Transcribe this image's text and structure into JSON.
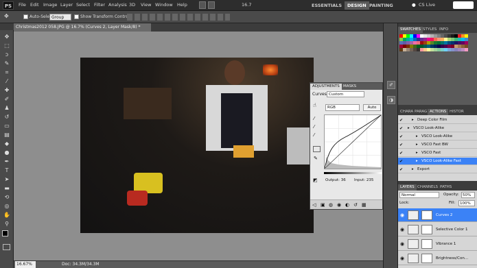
{
  "menu": {
    "logo": "PS",
    "items": [
      "File",
      "Edit",
      "Image",
      "Layer",
      "Select",
      "Filter",
      "Analysis",
      "3D",
      "View",
      "Window",
      "Help"
    ],
    "zoom": "16.7",
    "workspaces": [
      "ESSENTIALS",
      "DESIGN",
      "PAINTING"
    ],
    "active_workspace": "DESIGN",
    "cs_live": "CS Live"
  },
  "options": {
    "auto_select_label": "Auto-Select:",
    "auto_select_value": "Group",
    "show_transform_label": "Show Transform Controls"
  },
  "document": {
    "tab_title": "Christmas2012 058.JPG @ 16.7% (Curves 2, Layer Mask/8) *",
    "zoom_status": "16.67%",
    "doc_status": "Doc: 34.3M/34.3M"
  },
  "adjustments": {
    "tabs": [
      "ADJUSTMENTS",
      "MASKS"
    ],
    "active_tab": "ADJUSTMENTS",
    "type_label": "Curves",
    "preset": "Custom",
    "channel": "RGB",
    "auto_label": "Auto",
    "output_label": "Output: 36",
    "input_label": "Input: 235"
  },
  "swatches": {
    "tabs": [
      "SWATCHES",
      "STYLES",
      "INFO"
    ],
    "active_tab": "SWATCHES",
    "colors": [
      "#ff0000",
      "#ffff00",
      "#00ff00",
      "#00ffff",
      "#0000ff",
      "#ff00ff",
      "#ffffff",
      "#e6e6e6",
      "#cccccc",
      "#b3b3b3",
      "#999999",
      "#808080",
      "#666666",
      "#4d4d4d",
      "#333333",
      "#1a1a1a",
      "#000000",
      "#ed1c24",
      "#f7941d",
      "#fff200",
      "#8dc63f",
      "#00a651",
      "#00a99d",
      "#00aeef",
      "#0072bc",
      "#2e3192",
      "#662d91",
      "#92278f",
      "#ec008c",
      "#ed145b",
      "#f26c4f",
      "#f69679",
      "#fbaf5d",
      "#fff799",
      "#acd373",
      "#7cc576",
      "#3bb878",
      "#1abbb4",
      "#00bff3",
      "#438ccb",
      "#5574b9",
      "#605ca8",
      "#855fa8",
      "#a763a8",
      "#f06eaa",
      "#f26d7d",
      "#9e0b0f",
      "#a0410d",
      "#aba000",
      "#598527",
      "#197b30",
      "#007236",
      "#00746b",
      "#0076a3",
      "#004a80",
      "#003471",
      "#1b1464",
      "#440e62",
      "#630460",
      "#9e005d",
      "#9e0039",
      "#790000",
      "#7b2e00",
      "#827b00",
      "#406618",
      "#005e20",
      "#005826",
      "#005952",
      "#005b7f",
      "#003663",
      "#002157",
      "#0d004c",
      "#32004b",
      "#4b0049",
      "#7b0046",
      "#7a0026",
      "#c69c6d",
      "#a67c52",
      "#8c6239",
      "#754c24",
      "#603913",
      "#c7b299",
      "#998675",
      "#736357",
      "#534741",
      "#362f2d",
      "#f5989d",
      "#fdc68a",
      "#fff79a",
      "#c4df9b",
      "#a3d39c",
      "#82ca9d",
      "#7bcdc8",
      "#6ecff6",
      "#7da7d9",
      "#8393ca",
      "#8781bd",
      "#a186be",
      "#bd8cbf",
      "#f49ac1"
    ]
  },
  "actions": {
    "tabs": [
      "CHARA",
      "PARAG",
      "ACTIONS",
      "HISTOR"
    ],
    "active_tab": "ACTIONS",
    "items": [
      {
        "label": "Deep Color Film",
        "selected": false,
        "indent": 1
      },
      {
        "label": "VSCO Look-Alike",
        "selected": false,
        "indent": 0
      },
      {
        "label": "VSCO Look-Alike",
        "selected": false,
        "indent": 2
      },
      {
        "label": "VSCO Fast BW",
        "selected": false,
        "indent": 2
      },
      {
        "label": "VSCO Fast",
        "selected": false,
        "indent": 2
      },
      {
        "label": "VSCO Look-Alike Fast",
        "selected": true,
        "indent": 2
      },
      {
        "label": "Export",
        "selected": false,
        "indent": 1
      }
    ]
  },
  "layers": {
    "tabs": [
      "LAYERS",
      "CHANNELS",
      "PATHS"
    ],
    "active_tab": "LAYERS",
    "blend_mode": "Normal",
    "opacity_label": "Opacity:",
    "opacity_value": "50%",
    "lock_label": "Lock:",
    "fill_label": "Fill:",
    "fill_value": "100%",
    "items": [
      {
        "name": "Curves 2",
        "selected": true
      },
      {
        "name": "Selective Color 1",
        "selected": false
      },
      {
        "name": "Vibrance 1",
        "selected": false
      },
      {
        "name": "Brightness/Con...",
        "selected": false
      }
    ]
  }
}
